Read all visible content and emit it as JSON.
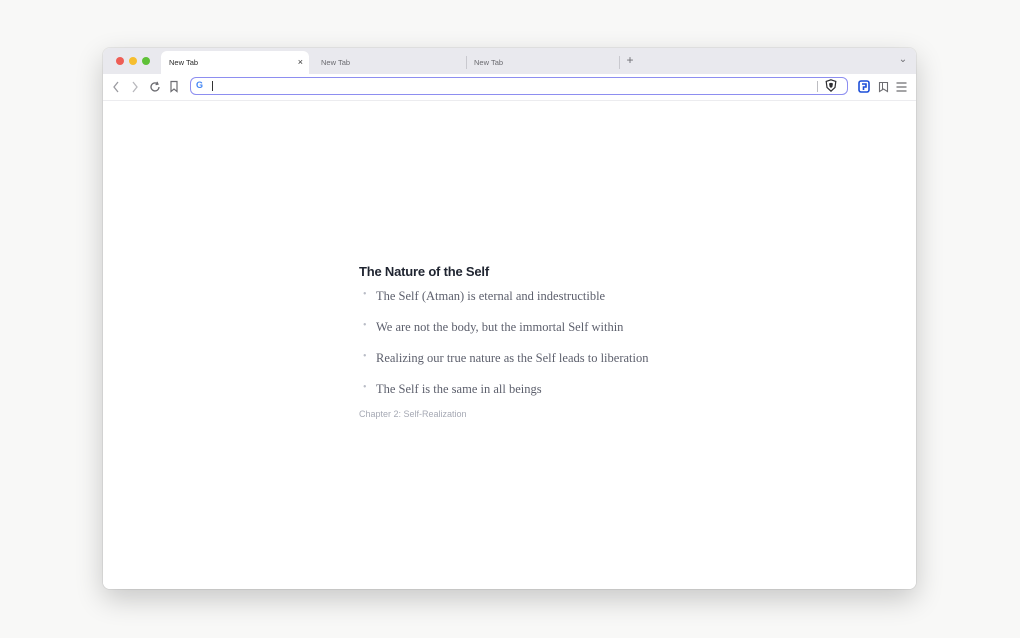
{
  "browser": {
    "tabs": [
      {
        "label": "New Tab",
        "active": true
      },
      {
        "label": "New Tab",
        "active": false
      },
      {
        "label": "New Tab",
        "active": false
      }
    ],
    "new_tab_icon": "+",
    "tab_list_icon": "⌄",
    "close_icon": "×",
    "address": {
      "value": "",
      "placeholder": ""
    },
    "search_engine_icon": "G",
    "toolbar_icons": [
      "back-icon",
      "forward-icon",
      "reload-icon",
      "bookmark-icon",
      "brave-shield-icon",
      "extension-icon",
      "sidebar-icon",
      "menu-icon"
    ],
    "accent": "#8d8ef0"
  },
  "page": {
    "title": "The Nature of the Self",
    "points": [
      "The Self (Atman) is eternal and indestructible",
      "We are not the body, but the immortal Self within",
      "Realizing our true nature as the Self leads to liberation",
      "The Self is the same in all beings"
    ],
    "bullet": "•",
    "chapter": "Chapter 2: Self-Realization"
  }
}
